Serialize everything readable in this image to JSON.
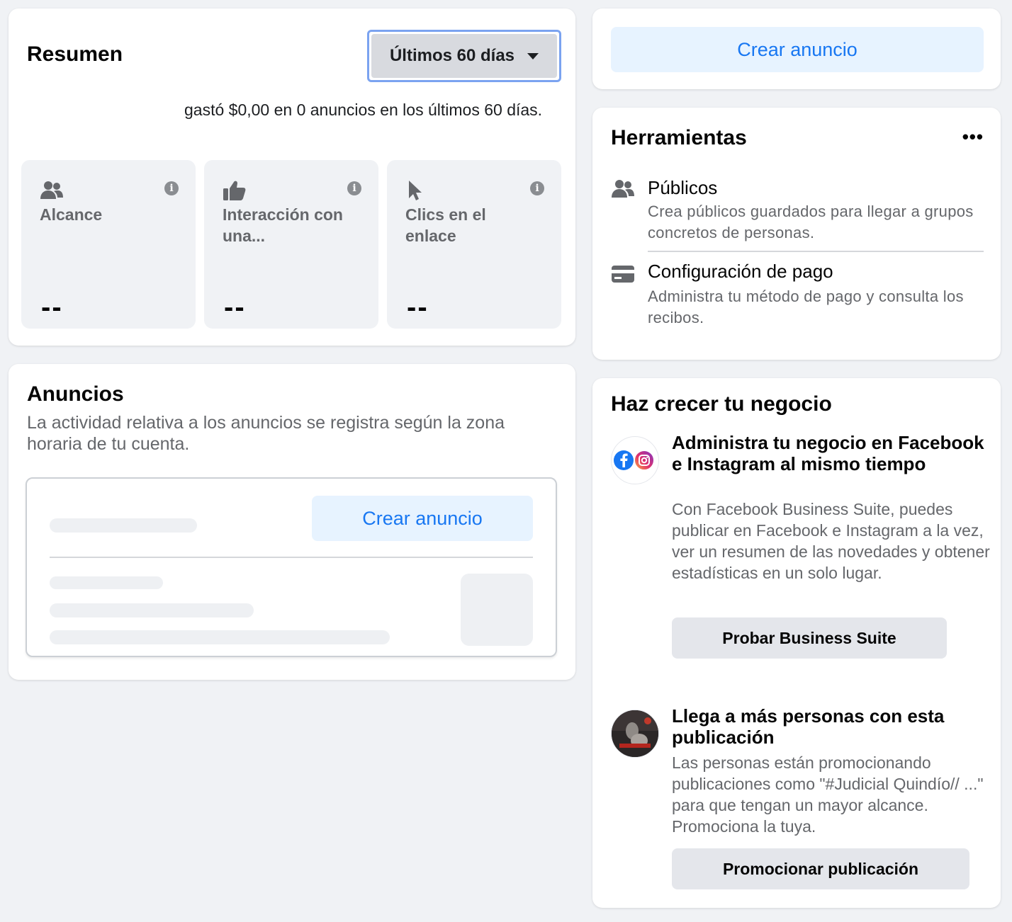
{
  "summary": {
    "title": "Resumen",
    "range_label": "Últimos 60 días",
    "spend_text": "gastó $0,00 en 0 anuncios en los últimos 60 días.",
    "metrics": [
      {
        "icon": "people-icon",
        "label": "Alcance",
        "value": "--"
      },
      {
        "icon": "thumbs-up-icon",
        "label": "Interacción con una...",
        "value": "--"
      },
      {
        "icon": "cursor-icon",
        "label": "Clics en el enlace",
        "value": "--"
      }
    ]
  },
  "ads": {
    "title": "Anuncios",
    "subtitle": "La actividad relativa a los anuncios se registra según la zona horaria de tu cuenta.",
    "create_label": "Crear anuncio"
  },
  "right": {
    "create_label": "Crear anuncio",
    "tools": {
      "title": "Herramientas",
      "more_label": "•••",
      "items": [
        {
          "icon": "people-icon",
          "title": "Públicos",
          "desc": "Crea públicos guardados para llegar a grupos concretos de personas."
        },
        {
          "icon": "credit-card-icon",
          "title": "Configuración de pago",
          "desc": "Administra tu método de pago y consulta los recibos."
        }
      ]
    },
    "grow": {
      "title": "Haz crecer tu negocio",
      "items": [
        {
          "title": "Administra tu negocio en Facebook e Instagram al mismo tiempo",
          "desc": "Con Facebook Business Suite, puedes publicar en Facebook e Instagram a la vez, ver un resumen de las novedades y obtener estadísticas en un solo lugar.",
          "button": "Probar Business Suite"
        },
        {
          "title": "Llega a más personas con esta publicación",
          "desc": "Las personas están promocionando publicaciones como \"#Judicial Quindío// ...\" para que tengan un mayor alcance. Promociona la tuya.",
          "button": "Promocionar publicación"
        }
      ]
    }
  },
  "colors": {
    "background": "#f0f2f5",
    "accent": "#1877f2",
    "accent_light": "#e7f3ff",
    "secondary_text": "#65676b"
  }
}
